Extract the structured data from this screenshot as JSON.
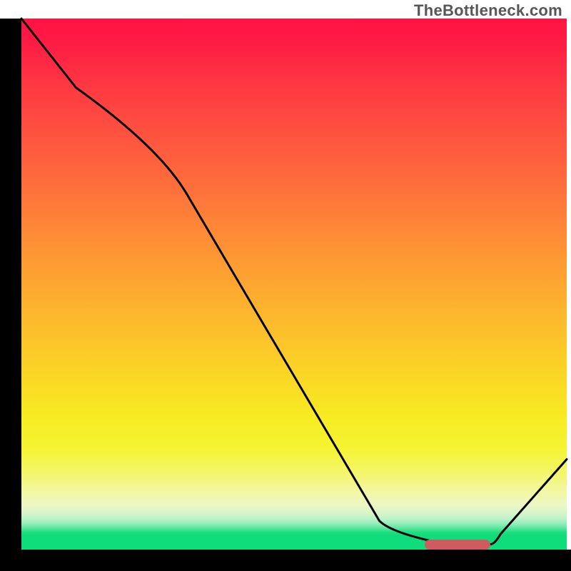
{
  "attribution": "TheBottleneck.com",
  "chart_data": {
    "type": "line",
    "title": "",
    "xlabel": "",
    "ylabel": "",
    "xlim": [
      0,
      100
    ],
    "ylim": [
      0,
      100
    ],
    "x": [
      0,
      10,
      25,
      68,
      78,
      86,
      100
    ],
    "values": [
      100,
      87,
      76,
      3,
      1,
      1,
      17
    ],
    "marker": {
      "x_start": 74,
      "x_end": 86,
      "y": 1
    },
    "notes": "Percent scale inferred from figure edges. Curve read from pixels: starts top-left at 100, shallow drop to ~76 at x≈25, then near-linear steep drop to ~3 at x≈68, flat minimum ≈1 over x≈74–86 (red marker), rises to ≈17 at right edge."
  },
  "colors": {
    "curve": "#000000",
    "marker": "#cf5b60",
    "green_base": "#0fdc7a",
    "top_red": "#fe1341"
  }
}
